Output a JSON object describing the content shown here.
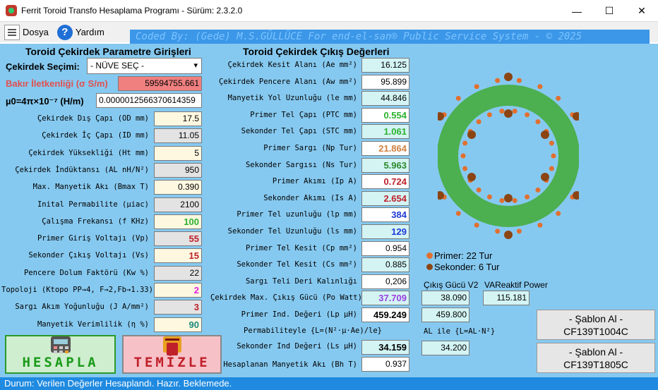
{
  "window": {
    "title": "Ferrit Toroid Transfo Hesaplama Programı - Sürüm: 2.3.2.0",
    "minimize_glyph": "—",
    "maximize_glyph": "☐",
    "close_glyph": "✕"
  },
  "menu": {
    "file_label": "Dosya",
    "help_label": "Yardım",
    "help_glyph": "?"
  },
  "banner": "Coded By: (Gede) M.S.GÜLLÜCE For end-el-san® Public Service System - © 2025",
  "inputs_panel": {
    "heading": "Toroid Çekirdek Parametre Girişleri",
    "core_select_label": "Çekirdek Seçimi:",
    "core_select_value": "- NÜVE SEÇ -",
    "select_arrow": "▾",
    "conductivity_label": "Bakır İletkenliği (σ  S/m)",
    "conductivity_value": "59594755.661",
    "mu0_label": "µ0=4π×10⁻⁷  (H/m)",
    "mu0_value": "0.0000012566370614359",
    "rows": [
      {
        "label": "Çekirdek  Dış Çapı (OD mm)",
        "value": "17.5",
        "bg": "#fff8e1",
        "color": "#000000"
      },
      {
        "label": "Çekirdek İç Çapı (ID mm)",
        "value": "11.05",
        "bg": "#e3e3e3",
        "color": "#000000"
      },
      {
        "label": "Çekirdek Yüksekliği (Ht mm)",
        "value": "5",
        "bg": "#fff8e1",
        "color": "#000000"
      },
      {
        "label": "Çekirdek İndüktansı (AL nH/N²)",
        "value": "950",
        "bg": "#e3e3e3",
        "color": "#000000"
      },
      {
        "label": "Max. Manyetik Akı (Bmax T)",
        "value": "0.390",
        "bg": "#fff8e1",
        "color": "#000000"
      },
      {
        "label": "Inital Permabilite (µiac)",
        "value": "2100",
        "bg": "#e3e3e3",
        "color": "#000000"
      },
      {
        "label": "Çalışma Frekansı (f KHz)",
        "value": "100",
        "bg": "#fff8e1",
        "color": "#2db02d"
      },
      {
        "label": "Primer Giriş Voltajı (Vp)",
        "value": "55",
        "bg": "#e3e3e3",
        "color": "#c0202a"
      },
      {
        "label": "Sekonder Çıkış Voltajı (Vs)",
        "value": "15",
        "bg": "#fff8e1",
        "color": "#c0202a"
      },
      {
        "label": "Pencere Dolum Faktörü (Kw %)",
        "value": "22",
        "bg": "#e3e3e3",
        "color": "#000000"
      },
      {
        "label": "Topoloji (Ktopo PP→4, F→2,Fb→1.33)",
        "value": "2",
        "bg": "#fff8e1",
        "color": "#e020e0"
      },
      {
        "label": "Sargı Akım Yoğunluğu (J A/mm²)",
        "value": "3",
        "bg": "#e3e3e3",
        "color": "#c0202a"
      },
      {
        "label": "Manyetik Verimlilik (η %)",
        "value": "90",
        "bg": "#fff8e1",
        "color": "#1a8a7a"
      }
    ],
    "calculate_button": "HESAPLA",
    "clear_button": "TEMİZLE"
  },
  "outputs_panel": {
    "heading": "Toroid Çekirdek Çıkış Değerleri",
    "rows": [
      {
        "label": "Çekirdek Kesit Alanı (Ae mm²)",
        "value": "16.125",
        "bg": "#d4f4f4",
        "color": "#000000"
      },
      {
        "label": "Çekirdek Pencere Alanı (Aw mm²)",
        "value": "95.899",
        "bg": "#ffffff",
        "color": "#000000"
      },
      {
        "label": "Manyetik Yol Uzunluğu (le mm)",
        "value": "44.846",
        "bg": "#d4f4f4",
        "color": "#000000"
      },
      {
        "label": "Primer Tel Çapı (PTC mm)",
        "value": "0.554",
        "bg": "#ffffff",
        "color": "#2db02d"
      },
      {
        "label": "Sekonder Tel Çapı (STC mm)",
        "value": "1.061",
        "bg": "#d4f4f4",
        "color": "#2db02d"
      },
      {
        "label": "Primer Sargı (Np Tur)",
        "value": "21.864",
        "bg": "#ffffff",
        "color": "#d08040"
      },
      {
        "label": "Sekonder Sargısı (Ns Tur)",
        "value": "5.963",
        "bg": "#d4f4f4",
        "color": "#2a8a2a"
      },
      {
        "label": "Primer Akımı (Ip A)",
        "value": "0.724",
        "bg": "#ffffff",
        "color": "#c0202a"
      },
      {
        "label": "Sekonder Akımı (Is A)",
        "value": "2.654",
        "bg": "#d4f4f4",
        "color": "#c0202a"
      },
      {
        "label": "Primer Tel uzunluğu (lp mm)",
        "value": "384",
        "bg": "#ffffff",
        "color": "#1f3ad6"
      },
      {
        "label": "Sekonder Tel Uzunluğu (ls mm)",
        "value": "129",
        "bg": "#d4f4f4",
        "color": "#1f3ad6"
      },
      {
        "label": "Primer Tel Kesit (Cp mm²)",
        "value": "0.954",
        "bg": "#ffffff",
        "color": "#000000"
      },
      {
        "label": "Sekonder Tel Kesit (Cs mm²)",
        "value": "0.885",
        "bg": "#d4f4f4",
        "color": "#000000"
      },
      {
        "label": "Sargı Teli Deri Kalınlığı",
        "value": "0,206",
        "bg": "#ffffff",
        "color": "#000000"
      },
      {
        "label": "Çekirdek Max. Çıkış Gücü (Po Watt)",
        "value": "37.709",
        "bg": "#d4f4f4",
        "color": "#9a40e0"
      },
      {
        "label": "Primer Ind. Değeri (Lp µH)",
        "value": "459.249",
        "bg": "#ffffff",
        "color": "#000000"
      }
    ],
    "permeability_formula": "Permabiliteyle {L=(N²·µ·Ae)/le}",
    "secondary_inductance_label": "Sekonder Ind Değeri (Ls µH)",
    "secondary_inductance_value": "34.159",
    "flux_label": "Hesaplanan Manyetik Akı (Bh T)",
    "flux_value": "0.937"
  },
  "extra_panel": {
    "output_power_v2_label": "Çıkış Gücü V2",
    "output_power_v2_value": "38.090",
    "vareactive_label": "VAReaktif Power",
    "vareactive_value": "115.181",
    "primer_al_value": "459.800",
    "al_formula": "AL ile {L=AL·N²}",
    "secondary_al_value": "34.200"
  },
  "legend": {
    "primary": "Primer: 22 Tur",
    "secondary": "Sekonder: 6 Tur",
    "primary_color": "#e07030",
    "secondary_color": "#8b4513"
  },
  "toroid": {
    "core_color": "#4caf50",
    "primary_turns": 22,
    "secondary_turns": 6
  },
  "template_buttons": [
    {
      "line1": "- Şablon Al -",
      "line2": "CF139T1004C"
    },
    {
      "line1": "- Şablon Al -",
      "line2": "CF139T1805C"
    }
  ],
  "status": "Durum: Verilen Değerler Hesaplandı.  Hazır. Beklemede."
}
